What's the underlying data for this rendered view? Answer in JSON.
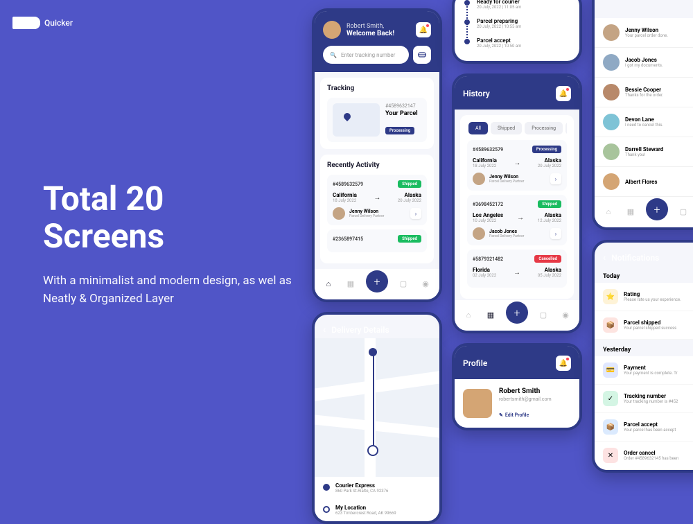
{
  "brand": "Quicker",
  "hero": {
    "title": "Total 20 Screens",
    "subtitle": "With a minimalist and modern design, as wel as Neatly & Organized Layer"
  },
  "home": {
    "greeting_name": "Robert Smith,",
    "greeting_back": "Welcome Back!",
    "search_placeholder": "Enter tracking number",
    "tracking_title": "Tracking",
    "track": {
      "id": "#4589632147",
      "label": "Your Parcel",
      "status": "Processing"
    },
    "recent_title": "Recently Activity",
    "acts": [
      {
        "id": "#4589632579",
        "status": "Shipped",
        "from": "California",
        "from_date": "18 July 2022",
        "to": "Alaska",
        "to_date": "20 July 2022",
        "person": "Jenny Wilson",
        "role": "Parcel Delivery Partner"
      },
      {
        "id": "#2365897415",
        "status": "Shipped"
      }
    ]
  },
  "timeline": [
    {
      "title": "Ready for courier",
      "time": "20 July, 2022 | 11:05 am"
    },
    {
      "title": "Parcel preparing",
      "time": "20 July, 2022 | 10:55 am"
    },
    {
      "title": "Parcel accept",
      "time": "20 July, 2022 | 10:50 am"
    }
  ],
  "history": {
    "title": "History",
    "tabs": [
      "All",
      "Shipped",
      "Processing",
      "Cancel"
    ],
    "items": [
      {
        "id": "#4589632579",
        "status": "Processing",
        "status_cls": "badge-blue",
        "from": "California",
        "from_date": "18 July 2022",
        "to": "Alaska",
        "to_date": "20 July 2022",
        "person": "Jenny Wilson",
        "role": "Parcel Delivery Partner"
      },
      {
        "id": "#3698452172",
        "status": "Shipped",
        "status_cls": "badge-green",
        "from": "Los Angeles",
        "from_date": "10 July 2022",
        "to": "Alaska",
        "to_date": "12 July 2022",
        "person": "Jacob Jones",
        "role": "Parcel Delivery Partner"
      },
      {
        "id": "#5879321482",
        "status": "Cancelled",
        "status_cls": "badge-red",
        "from": "Florida",
        "from_date": "02 July 2022",
        "to": "Alaska",
        "to_date": "05 July 2022"
      }
    ]
  },
  "messages": [
    {
      "name": "Jenny Wilson",
      "body": "Your parcel order done.",
      "color": "#c4a484"
    },
    {
      "name": "Jacob Jones",
      "body": "I got my documents.",
      "color": "#8fa9c4"
    },
    {
      "name": "Bessie Cooper",
      "body": "Thanks for the order.",
      "color": "#b8896a"
    },
    {
      "name": "Devon Lane",
      "body": "I need to cancel this.",
      "color": "#7ec3d6"
    },
    {
      "name": "Darrell Steward",
      "body": "Thank you!",
      "color": "#a8c49c"
    },
    {
      "name": "Albert Flores",
      "body": "",
      "color": "#d4a574"
    }
  ],
  "delivery": {
    "title": "Delivery Details",
    "courier": {
      "name": "Courier Express",
      "addr": "860 Park St.Rialto, CA 92376"
    },
    "mine": {
      "name": "My Location",
      "addr": "623 Timbercrest Road, AK 99669"
    }
  },
  "profile": {
    "title": "Profile",
    "name": "Robert Smith",
    "email": "robertsmith@gmail.com",
    "edit": "Edit Profile"
  },
  "notifications": {
    "title": "Notifications",
    "today": "Today",
    "yesterday": "Yesterday",
    "today_items": [
      {
        "icon": "⭐",
        "bg": "#fef3d7",
        "title": "Rating",
        "body": "Please rate us your experience."
      },
      {
        "icon": "📦",
        "bg": "#fde4e0",
        "title": "Parcel shipped",
        "body": "Your parcel shipped success"
      }
    ],
    "yest_items": [
      {
        "icon": "💳",
        "bg": "#e0e7ff",
        "title": "Payment",
        "body": "Your payment is complete. Tr"
      },
      {
        "icon": "✓",
        "bg": "#d4f5e4",
        "title": "Tracking number",
        "body": "Your tracking number is #452"
      },
      {
        "icon": "📦",
        "bg": "#dbeafe",
        "title": "Parcel accept",
        "body": "Your parcel has been accept"
      },
      {
        "icon": "✕",
        "bg": "#fde2e2",
        "title": "Order cancel",
        "body": "Order #4589632145 has been"
      }
    ]
  }
}
